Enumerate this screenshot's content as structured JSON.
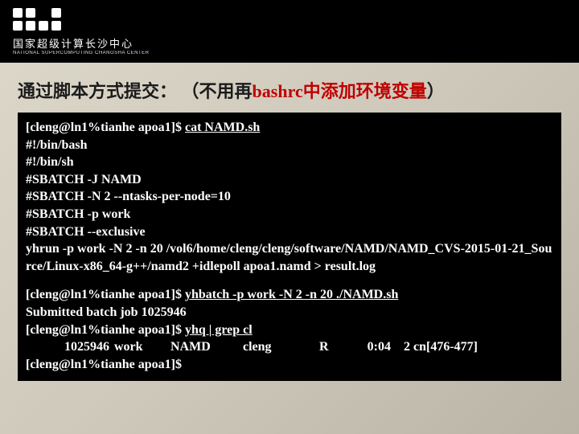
{
  "header": {
    "org_cn": "国家超级计算长沙中心",
    "org_en": "NATIONAL SUPERCOMPUTING CHANGSHA CENTER"
  },
  "title": {
    "prefix": "通过脚本方式提交：",
    "paren_open": "（",
    "note_plain": "不用再",
    "note_red": "bashrc中添加环境变量",
    "paren_close": "）"
  },
  "block1": {
    "prompt1": "[cleng@ln1%tianhe apoa1]$ ",
    "cmd1": "cat NAMD.sh",
    "l2": "#!/bin/bash",
    "l3": "#!/bin/sh",
    "l4": "#SBATCH -J NAMD",
    "l5": "#SBATCH -N 2 --ntasks-per-node=10",
    "l6": "#SBATCH -p work",
    "l7": "#SBATCH --exclusive",
    "l8": "yhrun -p work -N 2 -n 20 /vol6/home/cleng/cleng/software/NAMD/NAMD_CVS-2015-01-21_Source/Linux-x86_64-g++/namd2 +idlepoll apoa1.namd > result.log"
  },
  "block2": {
    "prompt1": "[cleng@ln1%tianhe apoa1]$ ",
    "cmd1": "yhbatch -p work -N 2 -n 20 ./NAMD.sh",
    "l2": "Submitted batch job 1025946",
    "prompt2": "[cleng@ln1%tianhe apoa1]$ ",
    "cmd2": "yhq | grep cl",
    "q_id": "1025946",
    "q_part": "work",
    "q_name": "NAMD",
    "q_user": "cleng",
    "q_state": "R",
    "q_time": "0:04",
    "q_nodes": "2 cn[476-477]",
    "prompt3": "[cleng@ln1%tianhe apoa1]$"
  }
}
